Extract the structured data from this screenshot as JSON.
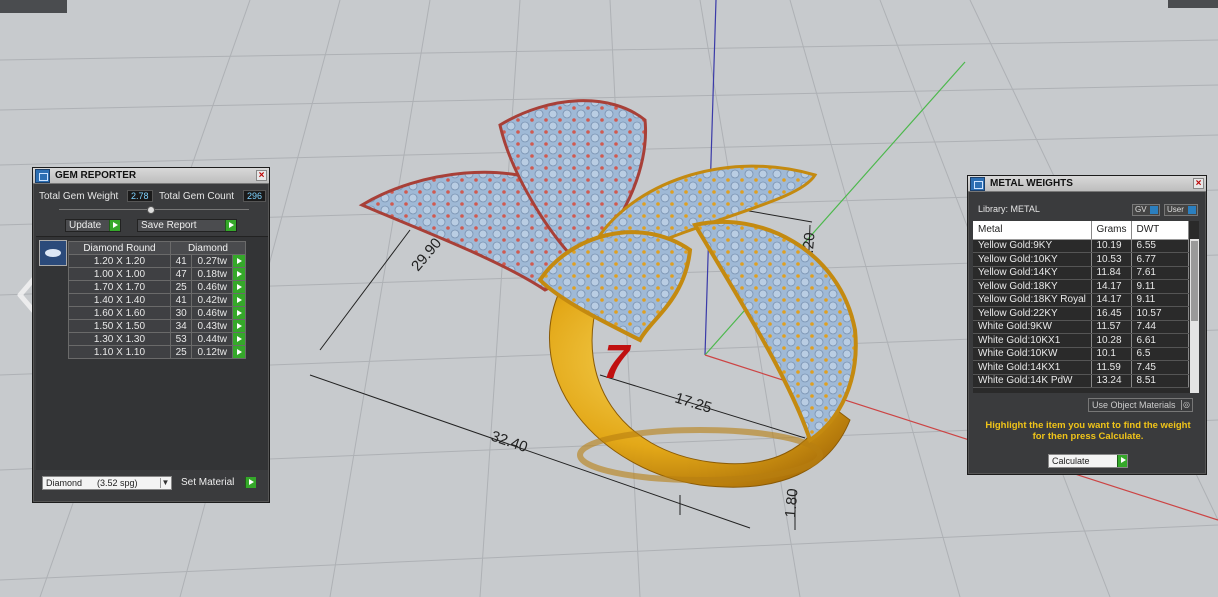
{
  "viewport": {
    "dimensions": {
      "d1": "29.90",
      "d2": "3.20",
      "d3": "17.25",
      "d4": "32.40",
      "d5": "1.80"
    },
    "ring_size": "7",
    "colors": {
      "background": "#c7cacd",
      "gold": "#e8b320",
      "rose": "#c9605a",
      "gem": "#9fb9d6",
      "ring_size": "#c01010"
    }
  },
  "gem_reporter": {
    "title": "GEM REPORTER",
    "total_weight_label": "Total Gem Weight",
    "total_weight_value": "2.78",
    "total_count_label": "Total Gem Count",
    "total_count_value": "296",
    "update_label": "Update",
    "save_label": "Save Report",
    "col_shape": "Diamond Round",
    "col_material": "Diamond",
    "rows": [
      {
        "size": "1.20 X 1.20",
        "count": "41",
        "weight": "0.27tw"
      },
      {
        "size": "1.00 X 1.00",
        "count": "47",
        "weight": "0.18tw"
      },
      {
        "size": "1.70 X 1.70",
        "count": "25",
        "weight": "0.46tw"
      },
      {
        "size": "1.40 X 1.40",
        "count": "41",
        "weight": "0.42tw"
      },
      {
        "size": "1.60 X 1.60",
        "count": "30",
        "weight": "0.46tw"
      },
      {
        "size": "1.50 X 1.50",
        "count": "34",
        "weight": "0.43tw"
      },
      {
        "size": "1.30 X 1.30",
        "count": "53",
        "weight": "0.44tw"
      },
      {
        "size": "1.10 X 1.10",
        "count": "25",
        "weight": "0.12tw"
      }
    ],
    "material_select": "Diamond      (3.52 spg)",
    "set_material_label": "Set Material"
  },
  "metal_weights": {
    "title": "METAL WEIGHTS",
    "library_label": "Library: METAL",
    "gv_label": "GV",
    "user_label": "User",
    "col_metal": "Metal",
    "col_grams": "Grams",
    "col_dwt": "DWT",
    "rows": [
      {
        "metal": "Yellow Gold:9KY",
        "grams": "10.19",
        "dwt": "6.55"
      },
      {
        "metal": "Yellow Gold:10KY",
        "grams": "10.53",
        "dwt": "6.77"
      },
      {
        "metal": "Yellow Gold:14KY",
        "grams": "11.84",
        "dwt": "7.61"
      },
      {
        "metal": "Yellow Gold:18KY",
        "grams": "14.17",
        "dwt": "9.11"
      },
      {
        "metal": "Yellow Gold:18KY Royal",
        "grams": "14.17",
        "dwt": "9.11"
      },
      {
        "metal": "Yellow Gold:22KY",
        "grams": "16.45",
        "dwt": "10.57"
      },
      {
        "metal": "White Gold:9KW",
        "grams": "11.57",
        "dwt": "7.44"
      },
      {
        "metal": "White Gold:10KX1",
        "grams": "10.28",
        "dwt": "6.61"
      },
      {
        "metal": "White Gold:10KW",
        "grams": "10.1",
        "dwt": "6.5"
      },
      {
        "metal": "White Gold:14KX1",
        "grams": "11.59",
        "dwt": "7.45"
      },
      {
        "metal": "White Gold:14K PdW",
        "grams": "13.24",
        "dwt": "8.51"
      }
    ],
    "use_object_materials": "Use Object Materials",
    "instruction": "Highlight the item you want to find the weight for then press Calculate.",
    "calculate_label": "Calculate"
  }
}
